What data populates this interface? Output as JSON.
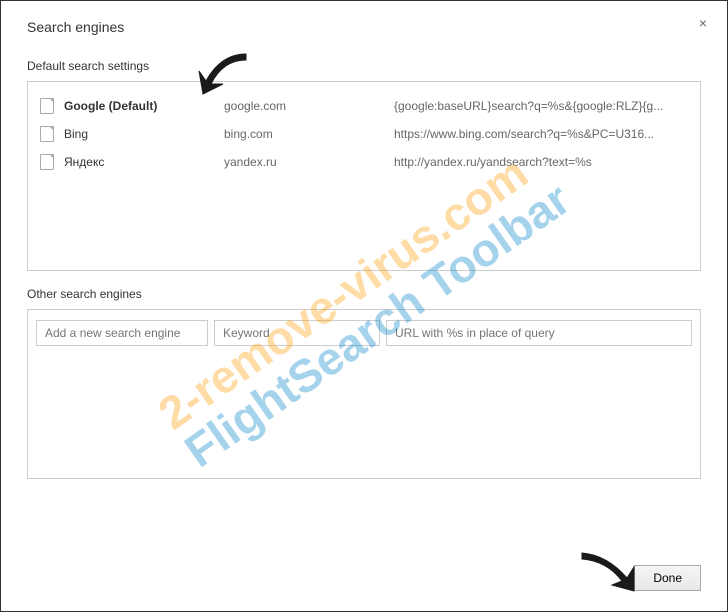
{
  "title": "Search engines",
  "close_label": "×",
  "section1": {
    "header": "Default search settings",
    "engines": [
      {
        "name": "Google (Default)",
        "keyword": "google.com",
        "url": "{google:baseURL}search?q=%s&{google:RLZ}{g...",
        "bold": true
      },
      {
        "name": "Bing",
        "keyword": "bing.com",
        "url": "https://www.bing.com/search?q=%s&PC=U316..."
      },
      {
        "name": "Яндекс",
        "keyword": "yandex.ru",
        "url": "http://yandex.ru/yandsearch?text=%s"
      }
    ]
  },
  "section2": {
    "header": "Other search engines",
    "placeholders": {
      "name": "Add a new search engine",
      "keyword": "Keyword",
      "url": "URL with %s in place of query"
    }
  },
  "done_label": "Done",
  "watermark": {
    "line1": "2-remove-virus.com",
    "line2": "FlightSearch Toolbar"
  }
}
